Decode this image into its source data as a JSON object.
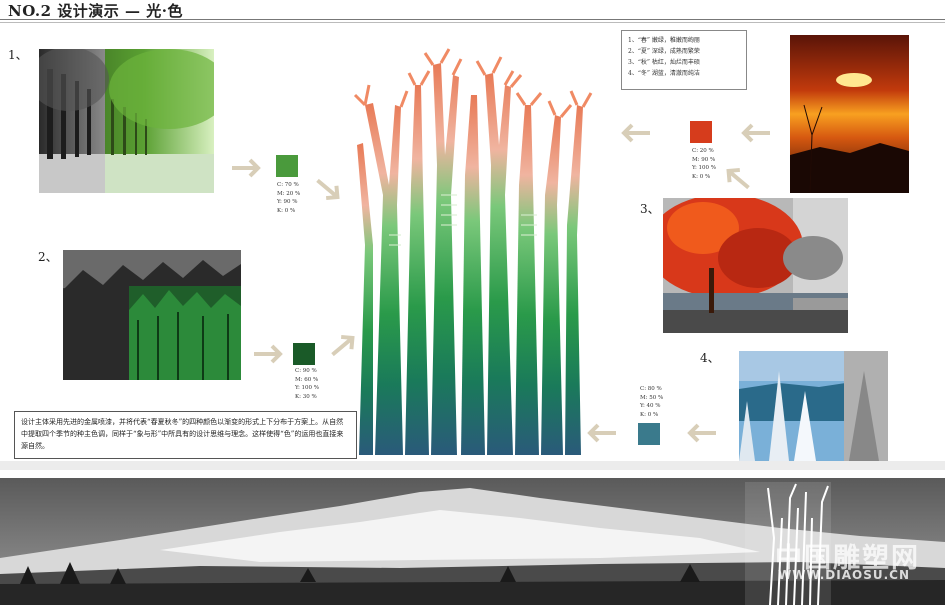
{
  "header": {
    "title": "NO.2 设计演示 — 光·色"
  },
  "numbers": [
    "1、",
    "2、",
    "3、",
    "4、"
  ],
  "swatches": [
    {
      "color": "#4a9a3c",
      "cmyk": [
        "C: 70 %",
        "M: 20 %",
        "Y: 90 %",
        "K: 0  %"
      ]
    },
    {
      "color": "#1a5a28",
      "cmyk": [
        "C: 90 %",
        "M: 60 %",
        "Y: 100 %",
        "K: 30 %"
      ]
    },
    {
      "color": "#d63c1c",
      "cmyk": [
        "C: 20 %",
        "M: 90 %",
        "Y: 100 %",
        "K: 0 %"
      ]
    },
    {
      "color": "#3a7a8c",
      "cmyk": [
        "C: 80 %",
        "M: 50 %",
        "Y: 40 %",
        "K: 0 %"
      ]
    }
  ],
  "legend": [
    "1、“春” 嫩绿，稚嫩而绚丽",
    "2、“夏” 深绿，成熟而繁荣",
    "3、“秋” 枯红，灿烂而丰硕",
    "4、“冬” 湖蓝，清澈而纯洁"
  ],
  "description": "设计主体采用先进的金属喷漆，并将代表“春夏秋冬”的四种颜色以渐变的形式上下分布于方案上。从自然中提取四个季节的种主色调，同样于“象与形”中所具有的设计思维与理念。这样使得“色”的运用也直接来源自然。",
  "watermark": {
    "cn": "中国雕塑网",
    "url": "WWW.DIAOSU.CN"
  }
}
